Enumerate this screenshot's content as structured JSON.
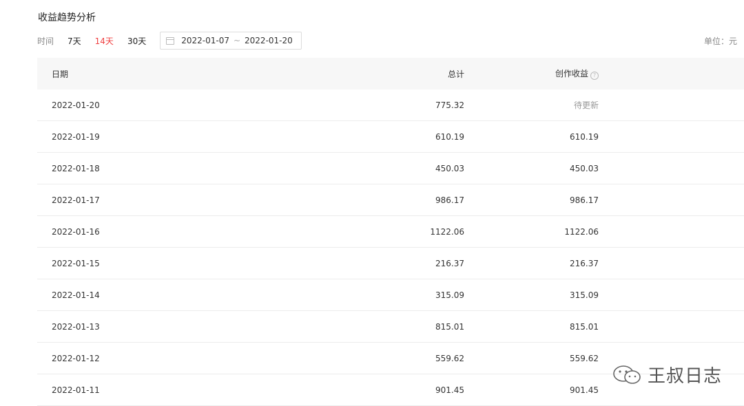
{
  "page": {
    "title": "收益趋势分析"
  },
  "filters": {
    "label": "时间",
    "ranges": [
      "7天",
      "14天",
      "30天"
    ],
    "active_range": "14天",
    "start_date": "2022-01-07",
    "separator": "~",
    "end_date": "2022-01-20",
    "unit": "单位：元"
  },
  "table": {
    "columns": {
      "date": "日期",
      "total": "总计",
      "earnings": "创作收益",
      "earnings_help": "?"
    },
    "rows": [
      {
        "date": "2022-01-20",
        "total": "775.32",
        "earnings": "待更新"
      },
      {
        "date": "2022-01-19",
        "total": "610.19",
        "earnings": "610.19"
      },
      {
        "date": "2022-01-18",
        "total": "450.03",
        "earnings": "450.03"
      },
      {
        "date": "2022-01-17",
        "total": "986.17",
        "earnings": "986.17"
      },
      {
        "date": "2022-01-16",
        "total": "1122.06",
        "earnings": "1122.06"
      },
      {
        "date": "2022-01-15",
        "total": "216.37",
        "earnings": "216.37"
      },
      {
        "date": "2022-01-14",
        "total": "315.09",
        "earnings": "315.09"
      },
      {
        "date": "2022-01-13",
        "total": "815.01",
        "earnings": "815.01"
      },
      {
        "date": "2022-01-12",
        "total": "559.62",
        "earnings": "559.62"
      },
      {
        "date": "2022-01-11",
        "total": "901.45",
        "earnings": "901.45"
      }
    ]
  },
  "watermark": {
    "text": "王叔日志",
    "icon": "wechat-icon"
  },
  "colors": {
    "active": "#f04142",
    "header_bg": "#f7f7f7",
    "row_border": "#ececec"
  }
}
